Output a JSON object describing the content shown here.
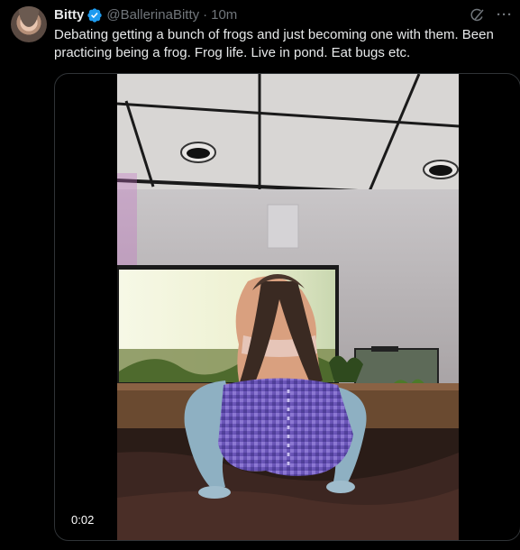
{
  "author": {
    "name": "Bitty",
    "handle": "@BallerinaBitty",
    "separator": "·",
    "time": "10m"
  },
  "tweet": {
    "text": "Debating getting a bunch of frogs and just becoming one with them. Been practicing being a frog. Frog life. Live in pond. Eat bugs etc."
  },
  "media": {
    "duration": "0:02"
  },
  "icons": {
    "verified": "verified-badge-icon",
    "grok": "grok-icon",
    "more": "more-options-icon"
  },
  "colors": {
    "background": "#000000",
    "text": "#e7e9ea",
    "secondary": "#71767b",
    "verified": "#1d9bf0",
    "border": "#2f3336"
  }
}
